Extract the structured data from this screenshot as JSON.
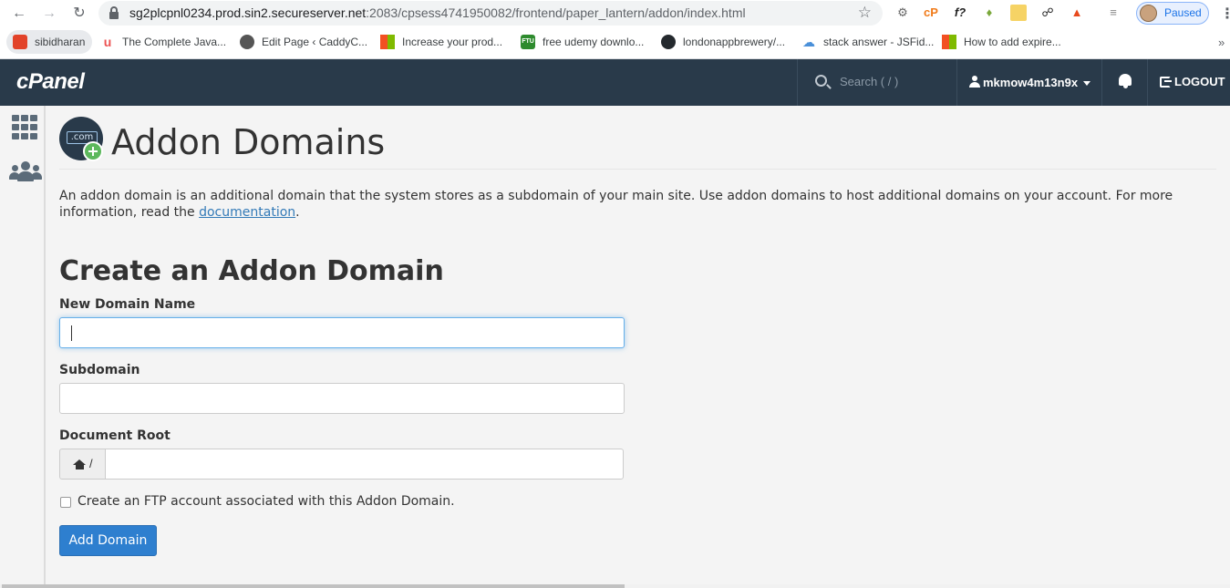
{
  "browser": {
    "url_host": "sg2plcpnl0234.prod.sin2.secureserver.net",
    "url_rest": ":2083/cpsess4741950082/frontend/paper_lantern/addon/index.html",
    "profile_status": "Paused",
    "extensions": [
      "cP",
      "f?"
    ],
    "bookmarks": [
      {
        "label": "sibidharan",
        "icon": "gitlab-icon"
      },
      {
        "label": "The Complete Java...",
        "icon": "udemy-icon"
      },
      {
        "label": "Edit Page ‹ CaddyC...",
        "icon": "wordpress-icon"
      },
      {
        "label": "Increase your prod...",
        "icon": "microsoft-icon"
      },
      {
        "label": "free udemy downlo...",
        "icon": "ftu-icon",
        "icon_text": "FTU"
      },
      {
        "label": "londonappbrewery/...",
        "icon": "github-icon"
      },
      {
        "label": "stack answer - JSFid...",
        "icon": "jsfiddle-icon"
      },
      {
        "label": "How to add expire...",
        "icon": "microsoft-icon"
      }
    ]
  },
  "cpanel": {
    "logo": "cPanel",
    "search_placeholder": "Search ( / )",
    "username": "mkmow4m13n9x",
    "logout_label": "LOGOUT"
  },
  "page": {
    "icon_text": ".com",
    "title": "Addon Domains",
    "intro_text": "An addon domain is an additional domain that the system stores as a subdomain of your main site. Use addon domains to host additional domains on your account. For more information, read the ",
    "intro_link": "documentation",
    "intro_end": ".",
    "section_title": "Create an Addon Domain",
    "fields": {
      "new_domain_label": "New Domain Name",
      "new_domain_value": "",
      "subdomain_label": "Subdomain",
      "subdomain_value": "",
      "docroot_label": "Document Root",
      "docroot_prefix": "/",
      "docroot_value": ""
    },
    "ftp_checkbox_label": "Create an FTP account associated with this Addon Domain.",
    "ftp_checked": false,
    "submit_label": "Add Domain"
  },
  "colors": {
    "topbar": "#293a4a",
    "primary_button": "#2e7fcf",
    "link": "#337ab7",
    "focus": "#66afe9"
  }
}
